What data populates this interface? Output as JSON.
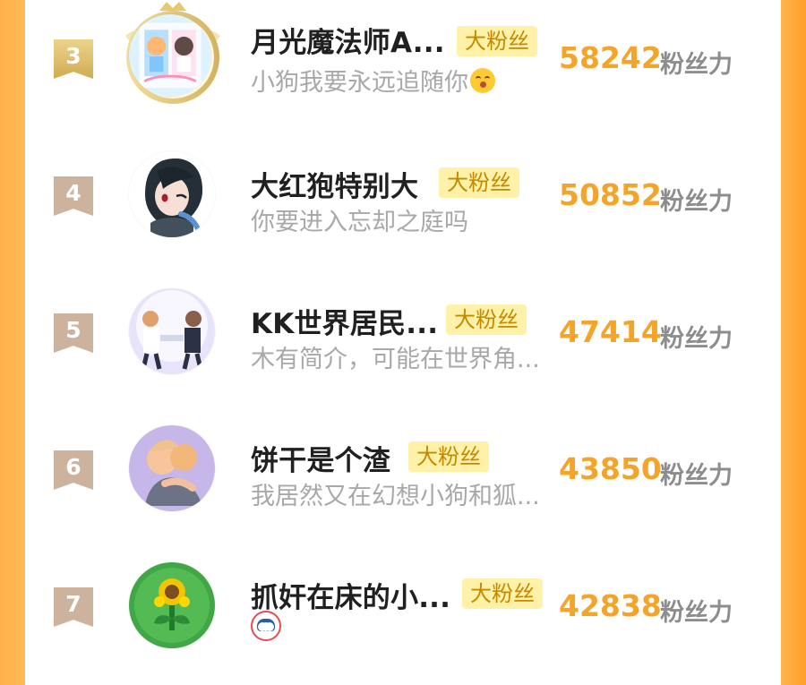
{
  "fans": [
    {
      "rank": "3",
      "name": "月光魔法师A...",
      "badge": "大粉丝",
      "intro": "小狗我要永远追随你",
      "score": "58242",
      "unit": "粉丝力",
      "intro_icon": "kiss-emoji-icon"
    },
    {
      "rank": "4",
      "name": "大红狍特别大",
      "badge": "大粉丝",
      "intro": "你要进入忘却之庭吗",
      "score": "50852",
      "unit": "粉丝力"
    },
    {
      "rank": "5",
      "name": "KK世界居民...",
      "badge": "大粉丝",
      "intro": "木有简介，可能在世界角...",
      "score": "47414",
      "unit": "粉丝力"
    },
    {
      "rank": "6",
      "name": "饼干是个渣",
      "badge": "大粉丝",
      "intro": "我居然又在幻想小狗和狐...",
      "score": "43850",
      "unit": "粉丝力"
    },
    {
      "rank": "7",
      "name": "抓奸在床的小...",
      "badge": "大粉丝",
      "score": "42838",
      "unit": "粉丝力",
      "intro_icon": "app-logo-icon"
    }
  ],
  "colors": {
    "accent": "#f4a428",
    "badge_bg": "#fff2a8",
    "badge_text": "#c58900"
  }
}
